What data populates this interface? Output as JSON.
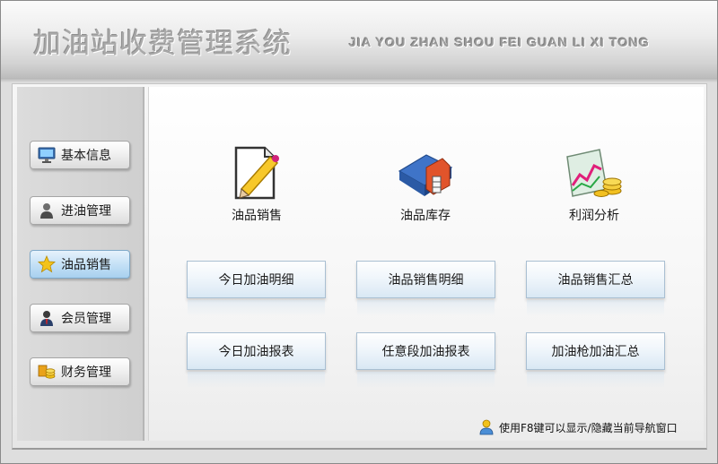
{
  "header": {
    "title_cn": "加油站收费管理系统",
    "title_en": "JIA YOU ZHAN SHOU FEI GUAN LI XI TONG"
  },
  "sidebar": {
    "items": [
      {
        "label": "基本信息",
        "icon": "monitor-icon",
        "active": false
      },
      {
        "label": "进油管理",
        "icon": "user-icon",
        "active": false
      },
      {
        "label": "油品销售",
        "icon": "star-icon",
        "active": true
      },
      {
        "label": "会员管理",
        "icon": "member-icon",
        "active": false
      },
      {
        "label": "财务管理",
        "icon": "coins-icon",
        "active": false
      }
    ]
  },
  "main": {
    "icons": [
      {
        "label": "油品销售",
        "icon": "pencil-document-icon"
      },
      {
        "label": "油品库存",
        "icon": "warehouse-icon"
      },
      {
        "label": "利润分析",
        "icon": "chart-coins-icon"
      }
    ],
    "buttons": [
      {
        "label": "今日加油明细"
      },
      {
        "label": "油品销售明细"
      },
      {
        "label": "油品销售汇总"
      },
      {
        "label": "今日加油报表"
      },
      {
        "label": "任意段加油报表"
      },
      {
        "label": "加油枪加油汇总"
      }
    ]
  },
  "footer": {
    "hint": "使用F8键可以显示/隐藏当前导航窗口",
    "hint_icon": "user-tip-icon"
  },
  "colors": {
    "active_nav": "#c5e1f6",
    "button_fill": "#e4eff8",
    "button_border": "#a9bfd2"
  }
}
